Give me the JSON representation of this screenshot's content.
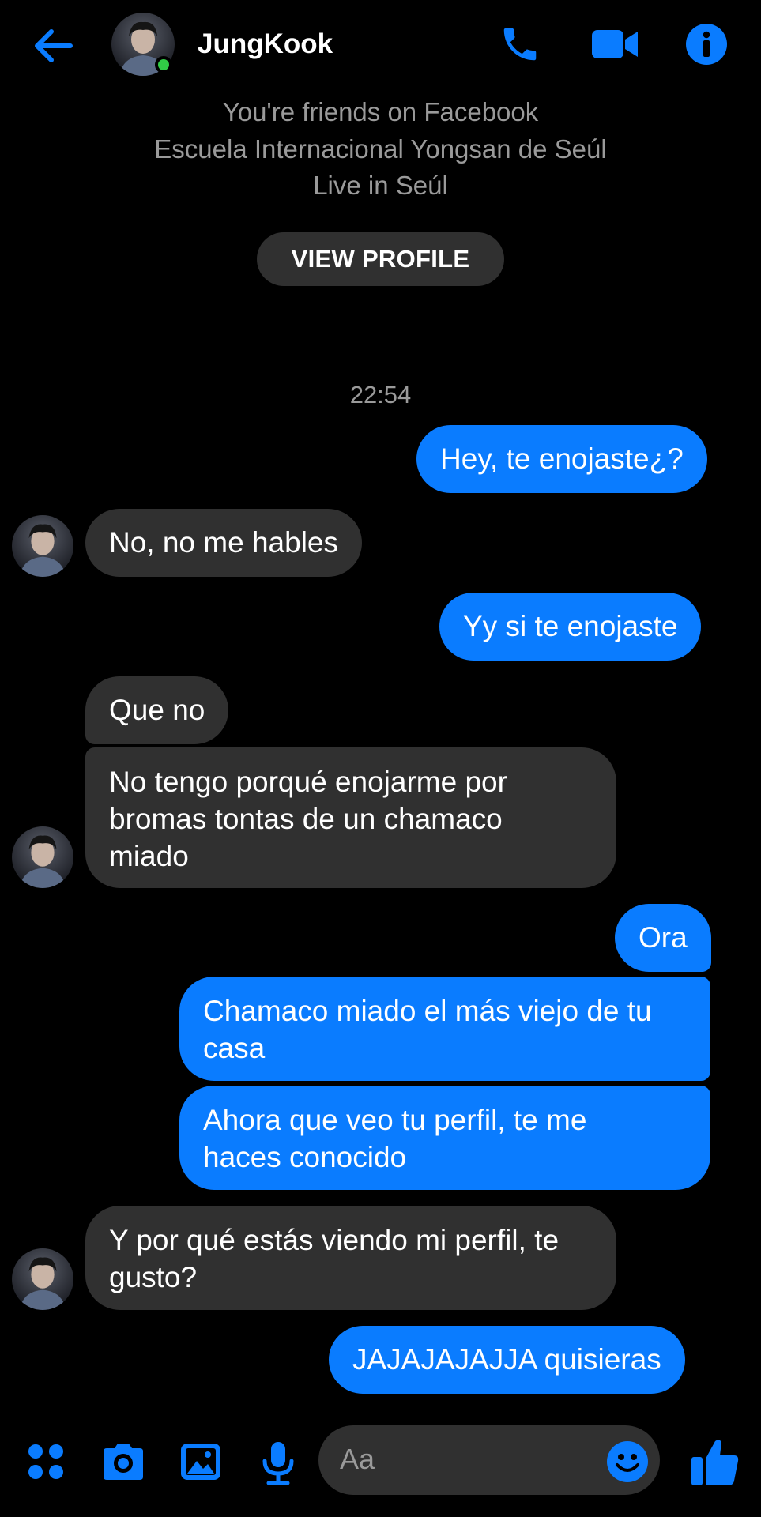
{
  "header": {
    "contact_name": "JungKook",
    "back_icon": "arrow-left-icon",
    "call_icon": "phone-icon",
    "video_icon": "video-camera-icon",
    "info_icon": "info-icon"
  },
  "profile": {
    "line1": "You're friends on Facebook",
    "line2": "Escuela Internacional Yongsan de Seúl",
    "line3": "Live in Seúl",
    "view_profile_label": "VIEW PROFILE"
  },
  "conversation": {
    "timestamp": "22:54",
    "messages": [
      {
        "from": "me",
        "text": "Hey, te enojaste¿?"
      },
      {
        "from": "them",
        "text": "No, no me hables"
      },
      {
        "from": "me",
        "text": "Yy si te enojaste"
      },
      {
        "from": "them",
        "text": "Que no"
      },
      {
        "from": "them",
        "line1": "No tengo porqué enojarme por",
        "line2": "bromas tontas de un chamaco",
        "line3": "miado"
      },
      {
        "from": "me",
        "text": "Ora"
      },
      {
        "from": "me",
        "line1": "Chamaco miado el más viejo de tu",
        "line2": "casa"
      },
      {
        "from": "me",
        "line1": "Ahora que veo tu perfil, te me",
        "line2": "haces conocido"
      },
      {
        "from": "them",
        "line1": "Y por qué estás viendo mi perfil, te",
        "line2": "gusto?"
      },
      {
        "from": "me",
        "text": "JAJAJAJAJJA quisieras"
      }
    ]
  },
  "composer": {
    "placeholder": "Aa",
    "apps_icon": "four-dots-icon",
    "camera_icon": "camera-icon",
    "gallery_icon": "image-icon",
    "mic_icon": "microphone-icon",
    "emoji_icon": "smiley-icon",
    "like_icon": "thumbs-up-icon"
  },
  "colors": {
    "accent": "#0a7cff",
    "incoming_bubble": "#303030",
    "background": "#000000",
    "secondary_text": "#9a9a9a",
    "online": "#31cc46"
  }
}
